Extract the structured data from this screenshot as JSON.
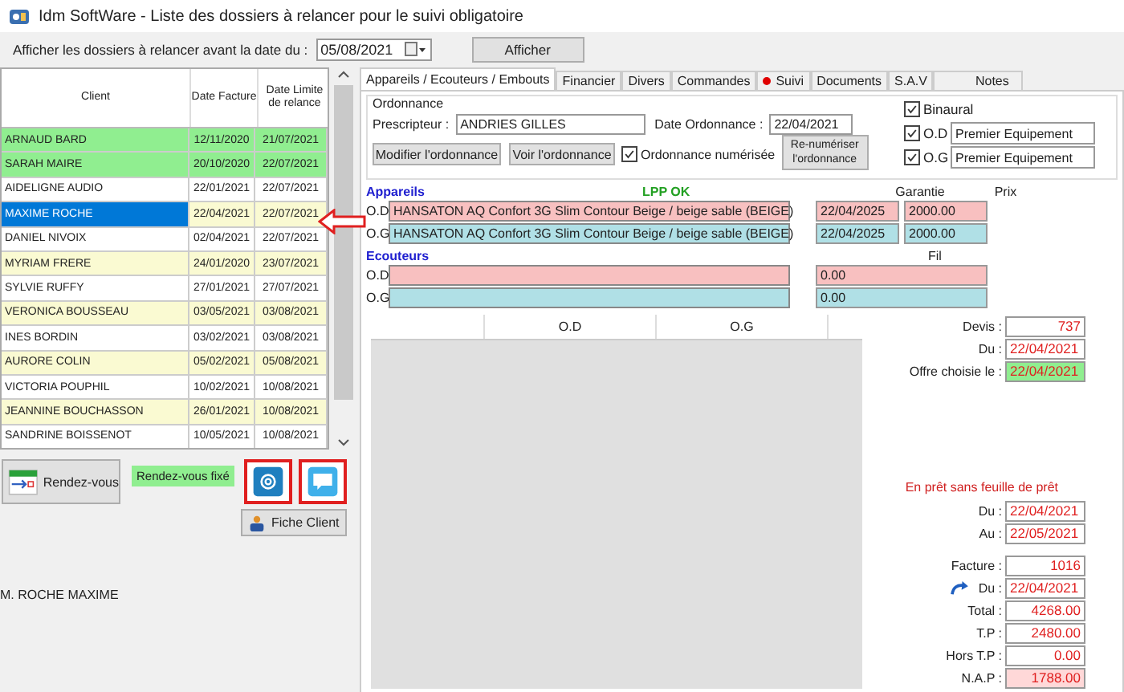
{
  "window": {
    "title": "Idm SoftWare - Liste des dossiers à relancer pour le suivi obligatoire"
  },
  "toolbar": {
    "label": "Afficher les dossiers à relancer avant la date du :",
    "date": "05/08/2021",
    "button": "Afficher"
  },
  "list": {
    "columns": [
      "Client",
      "Date Facture",
      "Date Limite de relance"
    ],
    "rows": [
      {
        "client": "ARNAUD BARD",
        "facture": "12/11/2020",
        "limite": "21/07/2021",
        "color": "#90ee90",
        "selected": false
      },
      {
        "client": "SARAH MAIRE",
        "facture": "20/10/2020",
        "limite": "22/07/2021",
        "color": "#90ee90",
        "selected": false
      },
      {
        "client": "AIDELIGNE AUDIO",
        "facture": "22/01/2021",
        "limite": "22/07/2021",
        "color": "#ffffff",
        "selected": false
      },
      {
        "client": "MAXIME ROCHE",
        "facture": "22/04/2021",
        "limite": "22/07/2021",
        "color": "#fafad2",
        "selected": true
      },
      {
        "client": "DANIEL NIVOIX",
        "facture": "02/04/2021",
        "limite": "22/07/2021",
        "color": "#ffffff",
        "selected": false
      },
      {
        "client": "MYRIAM FRERE",
        "facture": "24/01/2020",
        "limite": "23/07/2021",
        "color": "#fafad2",
        "selected": false
      },
      {
        "client": "SYLVIE RUFFY",
        "facture": "27/01/2021",
        "limite": "27/07/2021",
        "color": "#ffffff",
        "selected": false
      },
      {
        "client": "VERONICA BOUSSEAU",
        "facture": "03/05/2021",
        "limite": "03/08/2021",
        "color": "#fafad2",
        "selected": false
      },
      {
        "client": "INES BORDIN",
        "facture": "03/02/2021",
        "limite": "03/08/2021",
        "color": "#ffffff",
        "selected": false
      },
      {
        "client": "AURORE COLIN",
        "facture": "05/02/2021",
        "limite": "05/08/2021",
        "color": "#fafad2",
        "selected": false
      },
      {
        "client": "VICTORIA POUPHIL",
        "facture": "10/02/2021",
        "limite": "10/08/2021",
        "color": "#ffffff",
        "selected": false
      },
      {
        "client": "JEANNINE BOUCHASSON",
        "facture": "26/01/2021",
        "limite": "10/08/2021",
        "color": "#fafad2",
        "selected": false
      },
      {
        "client": "SANDRINE BOISSENOT",
        "facture": "10/05/2021",
        "limite": "10/08/2021",
        "color": "#ffffff",
        "selected": false
      }
    ]
  },
  "actions": {
    "appointment_button": "Rendez-vous",
    "appointment_badge": "Rendez-vous fixé",
    "client_button": "Fiche Client"
  },
  "client_name": "M. ROCHE MAXIME",
  "tabs": [
    {
      "label": "Appareils / Ecouteurs / Embouts",
      "selected": true,
      "alert": false
    },
    {
      "label": "Financier",
      "selected": false,
      "alert": false
    },
    {
      "label": "Divers",
      "selected": false,
      "alert": false
    },
    {
      "label": "Commandes",
      "selected": false,
      "alert": false
    },
    {
      "label": "Suivi",
      "selected": false,
      "alert": true
    },
    {
      "label": "Documents",
      "selected": false,
      "alert": false
    },
    {
      "label": "S.A.V",
      "selected": false,
      "alert": false
    },
    {
      "label": "Notes",
      "selected": false,
      "alert": false
    }
  ],
  "ordonnance": {
    "title": "Ordonnance",
    "prescripteur_label": "Prescripteur :",
    "prescripteur": "ANDRIES GILLES",
    "date_label": "Date Ordonnance :",
    "date": "22/04/2021",
    "buttons": [
      "Modifier l'ordonnance",
      "Voir l'ordonnance"
    ],
    "numerisee": {
      "label": "Ordonnance numérisée",
      "checked": true
    },
    "renumeriser": "Re-numériser l'ordonnance",
    "binaural": {
      "label": "Binaural",
      "checked": true
    },
    "sides": [
      {
        "label": "O.D",
        "checked": true,
        "value": "Premier Equipement"
      },
      {
        "label": "O.G",
        "checked": true,
        "value": "Premier Equipement"
      }
    ]
  },
  "appareils": {
    "title": "Appareils",
    "status": "LPP OK",
    "garantie_label": "Garantie",
    "prix_label": "Prix",
    "rows": [
      {
        "side": "O.D",
        "model": "HANSATON AQ Confort 3G Slim Contour Beige / beige sable (BEIGE)",
        "garantie": "22/04/2025",
        "prix": "2000.00",
        "color": "#f8c0c0"
      },
      {
        "side": "O.G",
        "model": "HANSATON AQ Confort 3G Slim Contour Beige / beige sable (BEIGE)",
        "garantie": "22/04/2025",
        "prix": "2000.00",
        "color": "#b0e0e6"
      }
    ]
  },
  "ecouteurs": {
    "title": "Ecouteurs",
    "fil_label": "Fil",
    "rows": [
      {
        "side": "O.D",
        "fil": "0.00",
        "color": "#f8c0c0"
      },
      {
        "side": "O.G",
        "fil": "0.00",
        "color": "#b0e0e6"
      }
    ]
  },
  "grid": {
    "columns": [
      "O.D",
      "O.G"
    ]
  },
  "quote": [
    {
      "label": "Devis :",
      "value": "737",
      "color": "#ffffff",
      "kind": "number"
    },
    {
      "label": "Du :",
      "value": "22/04/2021",
      "color": "#ffffff",
      "kind": "date"
    },
    {
      "label": "Offre choisie le :",
      "value": "22/04/2021",
      "color": "#90ee90",
      "kind": "date"
    }
  ],
  "loan": {
    "note": "En prêt sans feuille de prêt",
    "rows": [
      {
        "label": "Du :",
        "value": "22/04/2021",
        "color": "#ffffff"
      },
      {
        "label": "Au :",
        "value": "22/05/2021",
        "color": "#ffffff"
      }
    ]
  },
  "invoice": [
    {
      "label": "Facture :",
      "value": "1016",
      "color": "#ffffff",
      "kind": "number"
    },
    {
      "label": "Du :",
      "value": "22/04/2021",
      "color": "#ffffff",
      "kind": "linked-date"
    },
    {
      "label": "Total :",
      "value": "4268.00",
      "color": "#ffffff",
      "kind": "number"
    },
    {
      "label": "T.P :",
      "value": "2480.00",
      "color": "#ffffff",
      "kind": "number"
    },
    {
      "label": "Hors T.P :",
      "value": "0.00",
      "color": "#ffffff",
      "kind": "number"
    },
    {
      "label": "N.A.P :",
      "value": "1788.00",
      "color": "#ffd8d8",
      "kind": "number"
    }
  ]
}
